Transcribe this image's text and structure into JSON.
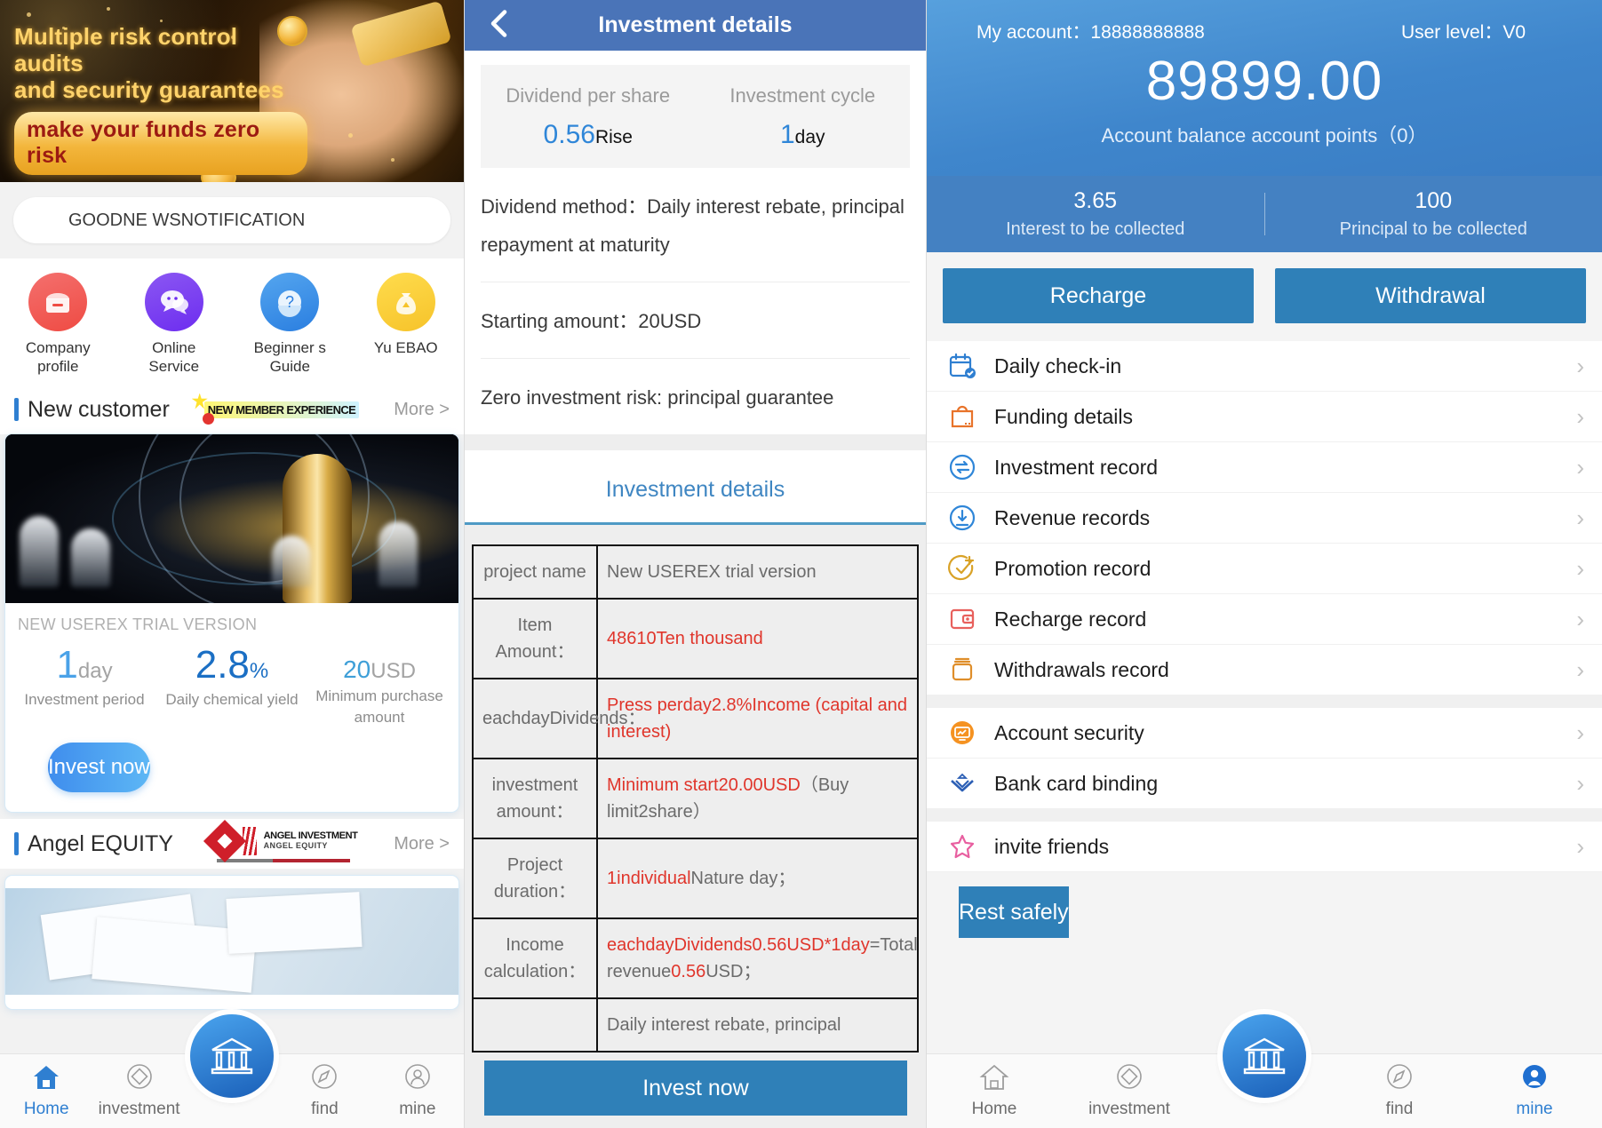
{
  "home": {
    "banner": {
      "line1": "Multiple risk control audits",
      "line2": "and security guarantees",
      "badge": "make your funds zero risk"
    },
    "search_placeholder": "GOODNE WSNOTIFICATION",
    "quick_icons": [
      {
        "label": "Company profile",
        "icon": "briefcase-icon",
        "color": "#ef4b43"
      },
      {
        "label": "Online Service",
        "icon": "chat-bubble-icon",
        "color": "#6d2df0"
      },
      {
        "label": "Beginner s Guide",
        "icon": "question-mark-icon",
        "color": "#2a7ee0"
      },
      {
        "label": "Yu EBAO",
        "icon": "money-bag-icon",
        "color": "#f6c32a"
      }
    ],
    "new_customer": {
      "title": "New customer",
      "ribbon": "NEW MEMBER EXPERIENCE",
      "more": "More >"
    },
    "product": {
      "name": "NEW USEREX TRIAL VERSION",
      "period_value": "1",
      "period_unit": "day",
      "period_label": "Investment period",
      "yield_value": "2.8",
      "yield_unit": "%",
      "yield_label": "Daily chemical yield",
      "min_value": "20",
      "min_unit": "USD",
      "min_label": "Minimum purchase amount",
      "invest_button": "Invest now"
    },
    "angel": {
      "title": "Angel EQUITY",
      "logo_line1": "ANGEL INVESTMENT",
      "logo_line2": "ANGEL  EQUITY",
      "more": "More >"
    },
    "tabs": [
      {
        "label": "Home",
        "icon": "home-icon",
        "active": true
      },
      {
        "label": "investment",
        "icon": "diamond-icon",
        "active": false
      },
      {
        "label": "find",
        "icon": "compass-icon",
        "active": false
      },
      {
        "label": "mine",
        "icon": "person-icon",
        "active": false
      }
    ],
    "center_tab_icon": "bank-icon"
  },
  "details": {
    "nav_title": "Investment details",
    "back_icon": "chevron-left-icon",
    "summary": [
      {
        "label": "Dividend per share",
        "value": "0.56",
        "suffix": "Rise"
      },
      {
        "label": "Investment cycle",
        "value": "1",
        "suffix": "day"
      }
    ],
    "info_rows": [
      "Dividend method：Daily interest rebate, principal repayment at maturity",
      "Starting amount：20USD",
      "Zero investment risk: principal guarantee"
    ],
    "table_title": "Investment details",
    "table": [
      {
        "k": "project name",
        "v_red": "",
        "v_gray": "New USEREX trial version"
      },
      {
        "k": "Item Amount：",
        "v_red": "48610Ten thousand",
        "v_gray": ""
      },
      {
        "k": "eachdayDividends：",
        "v_red": "Press perday2.8%Income (capital and interest)",
        "v_gray": ""
      },
      {
        "k": "investment amount：",
        "v_red": "Minimum start20.00USD",
        "v_gray": "（Buy limit2share）"
      },
      {
        "k": "Project duration：",
        "v_red": "1individual",
        "v_gray": "Nature day；"
      },
      {
        "k": "Income calculation：",
        "v_red": "eachdayDividends0.56USD*1day",
        "v_gray": "=Total revenue",
        "v_red2": "0.56",
        "v_gray2": "USD；"
      },
      {
        "k": "",
        "v_red": "",
        "v_gray": "Daily interest rebate, principal"
      }
    ],
    "invest_button": "Invest now"
  },
  "account": {
    "account_label": "My account：",
    "account_value": "18888888888",
    "level_label": "User level：",
    "level_value": "V0",
    "balance": "89899.00",
    "balance_label": "Account balance account points（0）",
    "stats": [
      {
        "value": "3.65",
        "label": "Interest to be collected"
      },
      {
        "value": "100",
        "label": "Principal to be collected"
      }
    ],
    "actions": [
      {
        "label": "Recharge"
      },
      {
        "label": "Withdrawal"
      }
    ],
    "menu_group_1": [
      {
        "label": "Daily check-in",
        "icon": "calendar-check-icon",
        "color": "#2f7fd1"
      },
      {
        "label": "Funding details",
        "icon": "shopping-bag-icon",
        "color": "#e8732a"
      },
      {
        "label": "Investment record",
        "icon": "exchange-circle-icon",
        "color": "#2f86d8"
      },
      {
        "label": "Revenue records",
        "icon": "download-circle-icon",
        "color": "#2f86d8"
      },
      {
        "label": "Promotion record",
        "icon": "check-plus-circle-icon",
        "color": "#d9a227"
      },
      {
        "label": "Recharge record",
        "icon": "wallet-icon",
        "color": "#e8605c"
      },
      {
        "label": "Withdrawals record",
        "icon": "box-icon",
        "color": "#df8e2a"
      }
    ],
    "menu_group_2": [
      {
        "label": "Account security",
        "icon": "shield-monitor-icon",
        "color": "#f59221"
      },
      {
        "label": "Bank card binding",
        "icon": "bank-card-icon",
        "color": "#2c5fb5"
      }
    ],
    "menu_group_3": [
      {
        "label": "invite friends",
        "icon": "star-icon",
        "color": "#e85fa0"
      }
    ],
    "bottom_button": "Rest safely",
    "tabs": [
      {
        "label": "Home",
        "icon": "home-icon",
        "active": false
      },
      {
        "label": "investment",
        "icon": "diamond-icon",
        "active": false
      },
      {
        "label": "find",
        "icon": "compass-icon",
        "active": false
      },
      {
        "label": "mine",
        "icon": "person-icon",
        "active": true
      }
    ],
    "center_tab_icon": "bank-icon"
  }
}
